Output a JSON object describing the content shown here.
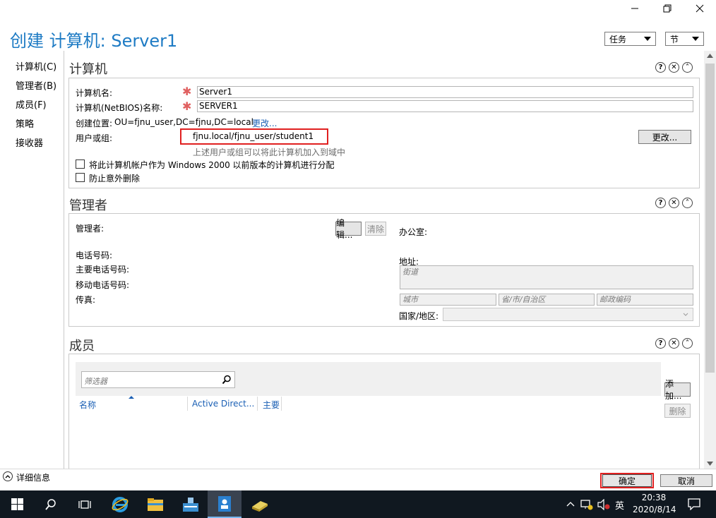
{
  "window": {
    "title": "创建 计算机: Server1",
    "tasks_label": "任务",
    "section_label": "节"
  },
  "nav": {
    "items": [
      "计算机(C)",
      "管理者(B)",
      "成员(F)",
      "策略",
      "接收器"
    ]
  },
  "computer": {
    "heading": "计算机",
    "name_label": "计算机名:",
    "name_value": "Server1",
    "netbios_label": "计算机(NetBIOS)名称:",
    "netbios_value": "SERVER1",
    "location_label": "创建位置:",
    "location_value": "OU=fjnu_user,DC=fjnu,DC=local",
    "location_change": "更改...",
    "user_group_label": "用户或组:",
    "user_group_value": "fjnu.local/fjnu_user/student1",
    "change_button": "更改...",
    "hint": "上述用户或组可以将此计算机加入到域中",
    "checkbox_pre2000": "将此计算机帐户作为 Windows 2000 以前版本的计算机进行分配",
    "checkbox_protect": "防止意外删除"
  },
  "manager": {
    "heading": "管理者",
    "managed_by_label": "管理者:",
    "edit_button": "编辑...",
    "clear_button": "清除",
    "office_label": "办公室:",
    "phone_label": "电话号码:",
    "main_phone_label": "主要电话号码:",
    "mobile_label": "移动电话号码:",
    "fax_label": "传真:",
    "address_label": "地址:",
    "street_placeholder": "街道",
    "city_placeholder": "城市",
    "province_placeholder": "省/市/自治区",
    "zip_placeholder": "邮政编码",
    "country_label": "国家/地区:"
  },
  "members": {
    "heading": "成员",
    "filter_placeholder": "筛选器",
    "columns": [
      "名称",
      "Active Direct...",
      "主要"
    ],
    "add_button": "添加...",
    "remove_button": "删除"
  },
  "footer": {
    "details": "详细信息",
    "ok_button": "确定",
    "cancel_button": "取消"
  },
  "taskbar": {
    "ime": "英",
    "time": "20:38",
    "date": "2020/8/14"
  },
  "colors": {
    "title": "#1e7bc4",
    "highlight": "#e02020",
    "taskbar": "#101820"
  }
}
